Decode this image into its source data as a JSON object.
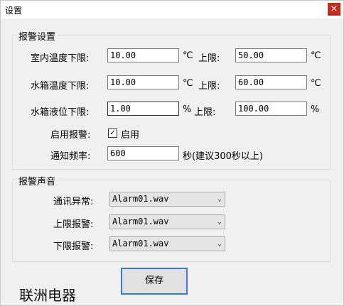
{
  "window": {
    "title": "设置",
    "close_glyph": "×"
  },
  "alarm_settings": {
    "title": "报警设置",
    "indoor": {
      "label": "室内温度下限:",
      "low": "10.00",
      "low_unit": "℃",
      "high_label": "上限:",
      "high": "50.00",
      "high_unit": "℃"
    },
    "tank_temp": {
      "label": "水箱温度下限:",
      "low": "10.00",
      "low_unit": "℃",
      "high_label": "上限:",
      "high": "60.00",
      "high_unit": "℃"
    },
    "tank_level": {
      "label": "水箱液位下限:",
      "low": "1.00",
      "low_unit": "%",
      "high_label": "上限:",
      "high": "100.00",
      "high_unit": "%"
    },
    "enable": {
      "label": "启用报警:",
      "checkbox_label": "启用",
      "checked": true,
      "check_glyph": "✓"
    },
    "frequency": {
      "label": "通知频率:",
      "value": "600",
      "suffix": "秒(建议300秒以上)"
    }
  },
  "alarm_sound": {
    "title": "报警声音",
    "items": [
      {
        "label": "通讯异常:",
        "value": "Alarm01.wav"
      },
      {
        "label": "上限报警:",
        "value": "Alarm01.wav"
      },
      {
        "label": "下限报警:",
        "value": "Alarm01.wav"
      }
    ],
    "arrow_glyph": "⌄"
  },
  "save_label": "保存",
  "brand_text": "联洲电器"
}
